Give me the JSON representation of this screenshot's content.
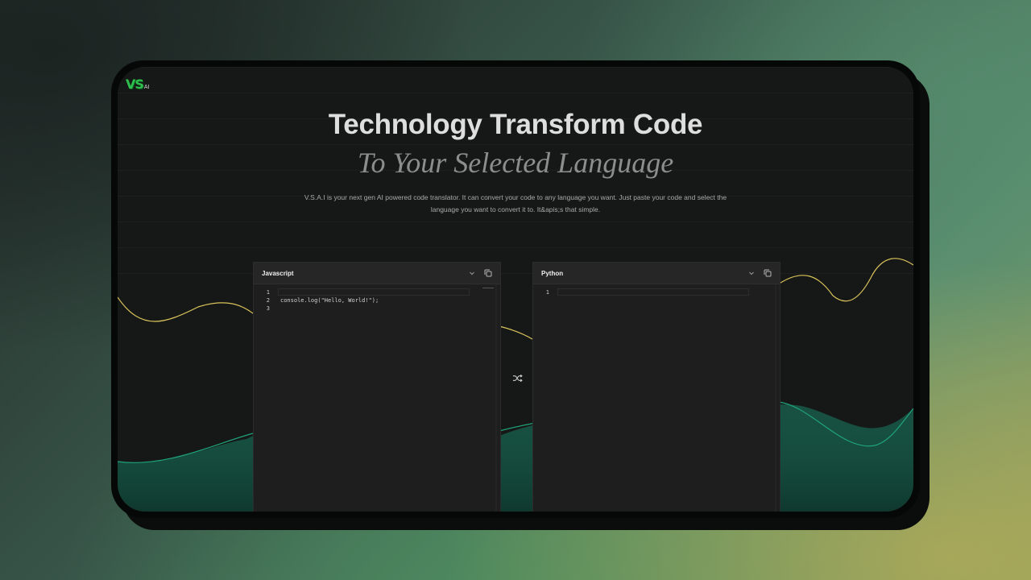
{
  "app": {
    "logo_text": "VS",
    "logo_sub": "AI"
  },
  "hero": {
    "title": "Technology Transform Code",
    "subtitle": "To Your Selected Language",
    "description": "V.S.A.I is your next gen AI powered code translator. It can convert your code to any language you want. Just paste your code and select the language you want to convert it to. It&apis;s that simple."
  },
  "source_editor": {
    "language": "Javascript",
    "lines": [
      {
        "number": "1",
        "code": ""
      },
      {
        "number": "2",
        "code": "console.log(\"Hello, World!\");"
      },
      {
        "number": "3",
        "code": ""
      }
    ],
    "icons": [
      "chevron-down-icon",
      "copy-icon"
    ]
  },
  "target_editor": {
    "language": "Python",
    "lines": [
      {
        "number": "1",
        "code": ""
      }
    ],
    "icons": [
      "chevron-down-icon",
      "copy-icon"
    ]
  },
  "swap": {
    "icon": "shuffle-icon"
  },
  "colors": {
    "logo_green": "#2fbf4f",
    "wave_yellow": "#d9c35a",
    "wave_teal": "#1fa37a",
    "editor_bg": "#1e1e1e",
    "screen_bg": "#161717"
  }
}
